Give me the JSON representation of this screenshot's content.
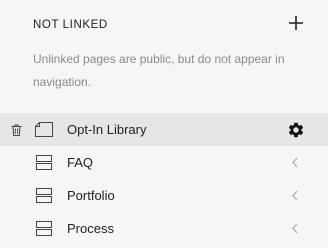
{
  "section": {
    "title": "NOT LINKED",
    "description": "Unlinked pages are public, but do not appear in navigation."
  },
  "pages": [
    {
      "label": "Opt-In Library",
      "icon": "page-icon",
      "active": true
    },
    {
      "label": "FAQ",
      "icon": "folder-icon",
      "active": false
    },
    {
      "label": "Portfolio",
      "icon": "folder-icon",
      "active": false
    },
    {
      "label": "Process",
      "icon": "folder-icon",
      "active": false
    }
  ],
  "colors": {
    "background": "#f6f6f6",
    "active_row": "#e6e6e6",
    "description_text": "#8a8a8a",
    "chevron": "#b5b5b5"
  }
}
